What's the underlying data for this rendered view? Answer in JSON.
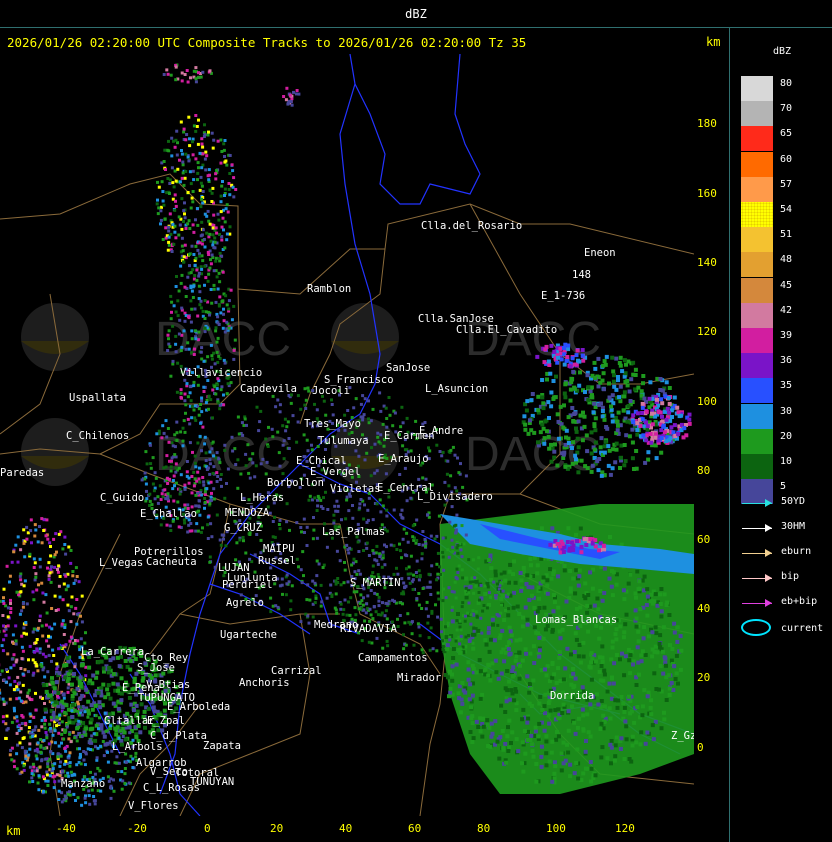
{
  "header": {
    "unit_title": "dBZ"
  },
  "headline": "2026/01/26 02:20:00 UTC Composite Tracks to 2026/01/26 02:20:00 Tz 35",
  "axis_unit": "km",
  "y_ticks": [
    "180",
    "160",
    "140",
    "120",
    "100",
    "80",
    "60",
    "40",
    "20",
    "0"
  ],
  "x_ticks": [
    "-40",
    "-20",
    "0",
    "20",
    "40",
    "60",
    "80",
    "100",
    "120"
  ],
  "watermark": {
    "text": "DACC"
  },
  "places": [
    {
      "name": "Clla.del_Rosario"
    },
    {
      "name": "Eneon"
    },
    {
      "name": "148"
    },
    {
      "name": "E_1-736"
    },
    {
      "name": "Ramblon"
    },
    {
      "name": "Clla.SanJose"
    },
    {
      "name": "Clla.El_Cavadito"
    },
    {
      "name": "Uspallata"
    },
    {
      "name": "Capdevila"
    },
    {
      "name": "S_Francisco"
    },
    {
      "name": "Jocoli"
    },
    {
      "name": "SanJose"
    },
    {
      "name": "L_Asuncion"
    },
    {
      "name": "Villavicencio"
    },
    {
      "name": "C_Chilenos"
    },
    {
      "name": "Tres_Mayo"
    },
    {
      "name": "Tulumaya"
    },
    {
      "name": "E_Andre"
    },
    {
      "name": "E_Carmen"
    },
    {
      "name": "E_Chical"
    },
    {
      "name": "E_Vergel"
    },
    {
      "name": "E_Araujo"
    },
    {
      "name": "Paredas"
    },
    {
      "name": "Borbollon"
    },
    {
      "name": "Violetas"
    },
    {
      "name": "E_Central"
    },
    {
      "name": "L_Divisadero"
    },
    {
      "name": "C_Guido"
    },
    {
      "name": "E_Challao"
    },
    {
      "name": "L_Heras"
    },
    {
      "name": "MENDOZA"
    },
    {
      "name": "G_CRUZ"
    },
    {
      "name": "Las_Palmas"
    },
    {
      "name": "Potrerillos"
    },
    {
      "name": "L_Vegas"
    },
    {
      "name": "Cacheuta"
    },
    {
      "name": "MAIPU"
    },
    {
      "name": "Russel"
    },
    {
      "name": "LUJAN"
    },
    {
      "name": "Lunlunta"
    },
    {
      "name": "Perdriel"
    },
    {
      "name": "S_MARTIN"
    },
    {
      "name": "Agrelo"
    },
    {
      "name": "Ugarteche"
    },
    {
      "name": "Lomas_Blancas"
    },
    {
      "name": "La_Carrera"
    },
    {
      "name": "Cto_Rey"
    },
    {
      "name": "S_Jose"
    },
    {
      "name": "Carrizal"
    },
    {
      "name": "RIVADAVIA"
    },
    {
      "name": "Medrano"
    },
    {
      "name": "Campamentos"
    },
    {
      "name": "E_Pena"
    },
    {
      "name": "V_Btias"
    },
    {
      "name": "Anchoris"
    },
    {
      "name": "TUPUNGATO"
    },
    {
      "name": "Mirador"
    },
    {
      "name": "E_Arboleda"
    },
    {
      "name": "Dorrida"
    },
    {
      "name": "Gltallar"
    },
    {
      "name": "E_Zpal"
    },
    {
      "name": "L_Arbols"
    },
    {
      "name": "C_d_Plata"
    },
    {
      "name": "Zapata"
    },
    {
      "name": "Algarrob"
    },
    {
      "name": "V_Seco"
    },
    {
      "name": "Totoral"
    },
    {
      "name": "Manzano"
    },
    {
      "name": "TUNUYAN"
    },
    {
      "name": "C_L_Rosas"
    },
    {
      "name": "V_Flores"
    },
    {
      "name": "Z_Gz"
    }
  ],
  "legend": {
    "title": "dBZ",
    "scale": [
      {
        "label": "80",
        "color": "#d8d8d8"
      },
      {
        "label": "70",
        "color": "#b4b4b4"
      },
      {
        "label": "65",
        "color": "#ff2a1a"
      },
      {
        "label": "60",
        "color": "#ff6a00"
      },
      {
        "label": "57",
        "color": "#ff9a4a"
      },
      {
        "label": "54",
        "color": "#ffff00"
      },
      {
        "label": "51",
        "color": "#f4c230"
      },
      {
        "label": "48",
        "color": "#e3a030"
      },
      {
        "label": "45",
        "color": "#d4883c"
      },
      {
        "label": "42",
        "color": "#d27aa0"
      },
      {
        "label": "39",
        "color": "#d21ea0"
      },
      {
        "label": "36",
        "color": "#7a14c8"
      },
      {
        "label": "35",
        "color": "#2850ff"
      },
      {
        "label": "30",
        "color": "#1e90e0"
      },
      {
        "label": "20",
        "color": "#1e9a1e"
      },
      {
        "label": "10",
        "color": "#0c6410"
      },
      {
        "label": "5",
        "color": "#46469a"
      }
    ],
    "tracks": [
      {
        "label": "50YD",
        "color": "#28e0e0"
      },
      {
        "label": "30HM",
        "color": "#ffffff"
      },
      {
        "label": "eburn",
        "color": "#f2d090"
      },
      {
        "label": "bip",
        "color": "#ffc8c8"
      },
      {
        "label": "eb+bip",
        "color": "#e040e0"
      }
    ],
    "current_label": "current",
    "current_color": "#00e5ff"
  },
  "colors": {
    "axis_text": "#ffff00",
    "frame": "#2f6f6f",
    "province_border": "#8a6a3a",
    "river": "#2233ff"
  }
}
